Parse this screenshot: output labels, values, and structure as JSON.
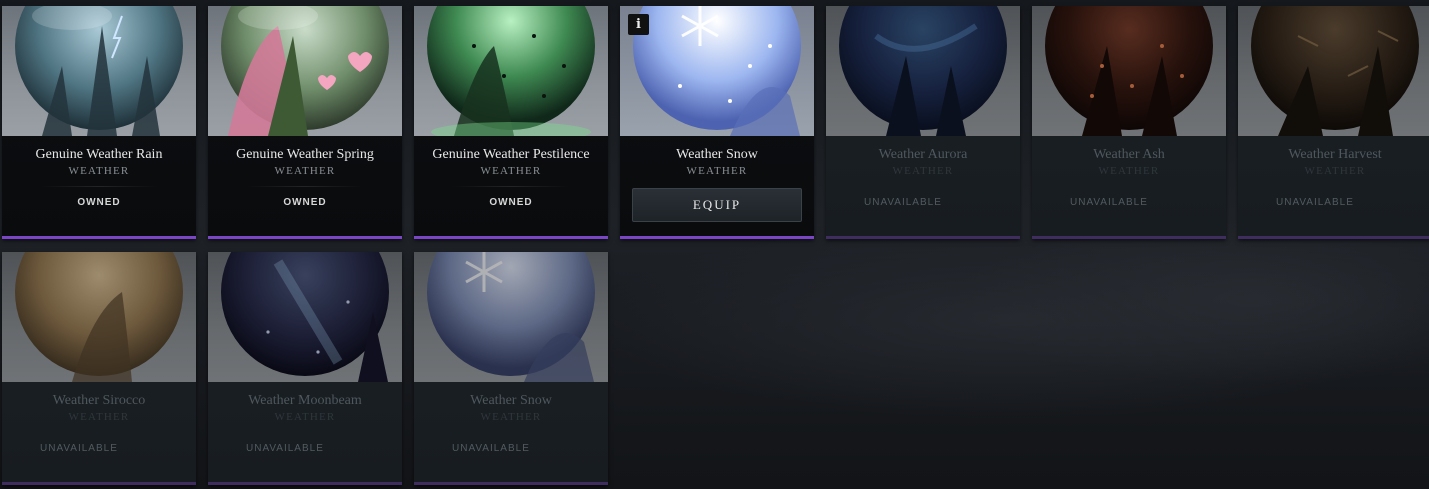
{
  "cards": [
    {
      "name": "Genuine Weather Rain",
      "type": "WEATHER",
      "status": "OWNED",
      "globe": "globe-rain"
    },
    {
      "name": "Genuine Weather Spring",
      "type": "WEATHER",
      "status": "OWNED",
      "globe": "globe-spring"
    },
    {
      "name": "Genuine Weather Pestilence",
      "type": "WEATHER",
      "status": "OWNED",
      "globe": "globe-pestilence"
    },
    {
      "name": "Weather Snow",
      "type": "WEATHER",
      "action": "EQUIP",
      "info_icon": "i",
      "globe": "globe-snow"
    },
    {
      "name": "Weather Aurora",
      "type": "WEATHER",
      "status": "UNAVAILABLE",
      "globe": "globe-aurora"
    },
    {
      "name": "Weather Ash",
      "type": "WEATHER",
      "status": "UNAVAILABLE",
      "globe": "globe-ash"
    },
    {
      "name": "Weather Harvest",
      "type": "WEATHER",
      "status": "UNAVAILABLE",
      "globe": "globe-harvest"
    },
    {
      "name": "Weather Sirocco",
      "type": "WEATHER",
      "status": "UNAVAILABLE",
      "globe": "globe-sirocco"
    },
    {
      "name": "Weather Moonbeam",
      "type": "WEATHER",
      "status": "UNAVAILABLE",
      "globe": "globe-moonbeam"
    },
    {
      "name": "Weather Snow",
      "type": "WEATHER",
      "status": "UNAVAILABLE",
      "globe": "globe-snow"
    }
  ],
  "colors": {
    "rarity_border": "#7b45c8",
    "card_bg": "#0b0c0e",
    "unavailable_bg": "#1b2126"
  }
}
